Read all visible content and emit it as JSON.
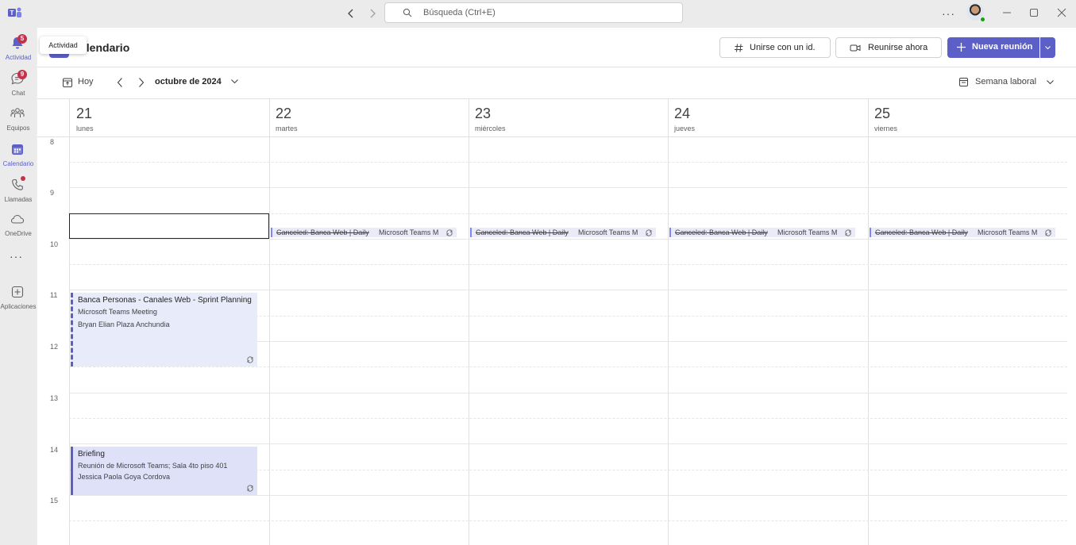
{
  "search": {
    "placeholder": "Búsqueda (Ctrl+E)"
  },
  "rail": {
    "items": [
      {
        "label": "Actividad",
        "icon": "bell-icon",
        "badge": "5"
      },
      {
        "label": "Chat",
        "icon": "chat-icon",
        "badge": "9"
      },
      {
        "label": "Equipos",
        "icon": "teams-icon"
      },
      {
        "label": "Calendario",
        "icon": "calendar-icon",
        "active": true
      },
      {
        "label": "Llamadas",
        "icon": "phone-icon",
        "dot": true
      },
      {
        "label": "OneDrive",
        "icon": "cloud-icon"
      },
      {
        "label": "Aplicaciones",
        "icon": "add-apps-icon"
      }
    ],
    "more": "···"
  },
  "tooltip": "Actividad",
  "header": {
    "title": "Calendario",
    "title_visible": "alendario",
    "join_label": "Unirse con un id.",
    "meet_label": "Reunirse ahora",
    "new_label": "Nueva reunión"
  },
  "toolbar": {
    "today_label": "Hoy",
    "month": "octubre de 2024",
    "view": "Semana laboral"
  },
  "days": [
    {
      "num": "21",
      "name": "lunes"
    },
    {
      "num": "22",
      "name": "martes"
    },
    {
      "num": "23",
      "name": "miércoles"
    },
    {
      "num": "24",
      "name": "jueves"
    },
    {
      "num": "25",
      "name": "viernes"
    }
  ],
  "hours": [
    "8",
    "9",
    "10",
    "11",
    "12",
    "13",
    "14",
    "15"
  ],
  "canceled_event": {
    "title": "Canceled: Banca Web | Daily",
    "location": "Microsoft Teams M"
  },
  "events": {
    "sprint": {
      "title": "Banca Personas - Canales Web - Sprint Planning",
      "location": "Microsoft Teams Meeting",
      "organizer": "Bryan Elian Plaza Anchundia"
    },
    "briefing": {
      "title": "Briefing",
      "location": "Reunión de Microsoft Teams; Sala 4to piso 401",
      "organizer": "Jessica Paola Goya Cordova"
    }
  },
  "colors": {
    "accent": "#5b5fc7",
    "badge": "#c4314b",
    "event_bg": "#e8ebfa"
  }
}
